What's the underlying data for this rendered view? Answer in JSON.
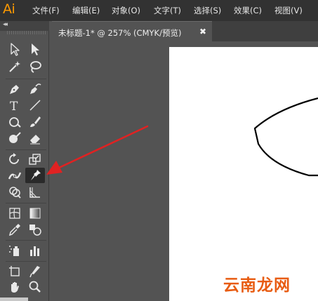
{
  "app": {
    "logo": "Ai",
    "brand_color": "#ff9a00"
  },
  "menu": {
    "items": [
      {
        "label": "文件(F)"
      },
      {
        "label": "编辑(E)"
      },
      {
        "label": "对象(O)"
      },
      {
        "label": "文字(T)"
      },
      {
        "label": "选择(S)"
      },
      {
        "label": "效果(C)"
      },
      {
        "label": "视图(V)"
      }
    ]
  },
  "toolbar": {
    "collapse": "◂◂",
    "tools": [
      {
        "name": "selection-tool"
      },
      {
        "name": "direct-selection-tool"
      },
      {
        "name": "magic-wand-tool"
      },
      {
        "name": "lasso-tool"
      },
      {
        "name": "pen-tool"
      },
      {
        "name": "curvature-tool"
      },
      {
        "name": "type-tool"
      },
      {
        "name": "line-segment-tool"
      },
      {
        "name": "shaper-tool"
      },
      {
        "name": "paintbrush-tool"
      },
      {
        "name": "blob-brush-tool"
      },
      {
        "name": "eraser-tool"
      },
      {
        "name": "rotate-tool"
      },
      {
        "name": "scale-tool"
      },
      {
        "name": "width-tool"
      },
      {
        "name": "puppet-warp-tool",
        "active": true
      },
      {
        "name": "shape-builder-tool"
      },
      {
        "name": "perspective-grid-tool"
      },
      {
        "name": "mesh-tool"
      },
      {
        "name": "gradient-tool"
      },
      {
        "name": "eyedropper-tool"
      },
      {
        "name": "blend-tool"
      },
      {
        "name": "symbol-sprayer-tool"
      },
      {
        "name": "column-graph-tool"
      },
      {
        "name": "artboard-tool"
      },
      {
        "name": "slice-tool"
      },
      {
        "name": "hand-tool"
      },
      {
        "name": "zoom-tool"
      }
    ]
  },
  "document": {
    "tab_title": "未标题-1* @ 257% (CMYK/预览)",
    "close_glyph": "✖"
  },
  "annotation": {
    "arrow_color": "#e02222"
  },
  "watermark": {
    "text": "云南龙网",
    "color": "#e85c12"
  }
}
